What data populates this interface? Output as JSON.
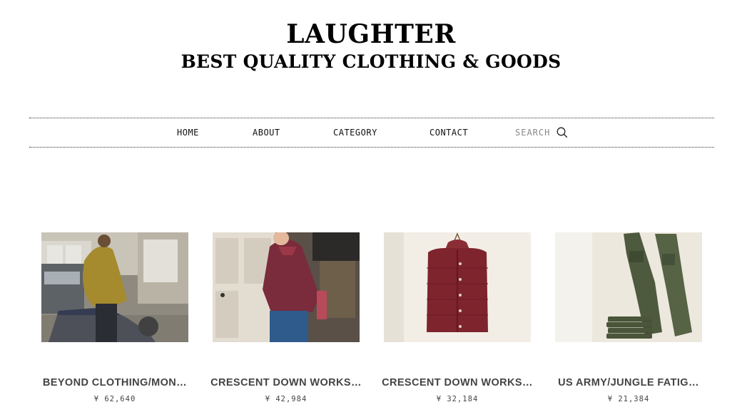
{
  "header": {
    "title": "LAUGHTER",
    "tagline": "BEST QUALITY CLOTHING & GOODS"
  },
  "nav": {
    "items": [
      "HOME",
      "ABOUT",
      "CATEGORY",
      "CONTACT"
    ],
    "search_label": "SEARCH",
    "search_icon": "search-icon"
  },
  "products": [
    {
      "name": "BEYOND CLOTHING/MON…",
      "price": "¥ 62,640"
    },
    {
      "name": "CRESCENT DOWN WORKS…",
      "price": "¥ 42,984"
    },
    {
      "name": "CRESCENT DOWN WORKS…",
      "price": "¥ 32,184"
    },
    {
      "name": "US ARMY/JUNGLE FATIG…",
      "price": "¥ 21,384"
    }
  ]
}
